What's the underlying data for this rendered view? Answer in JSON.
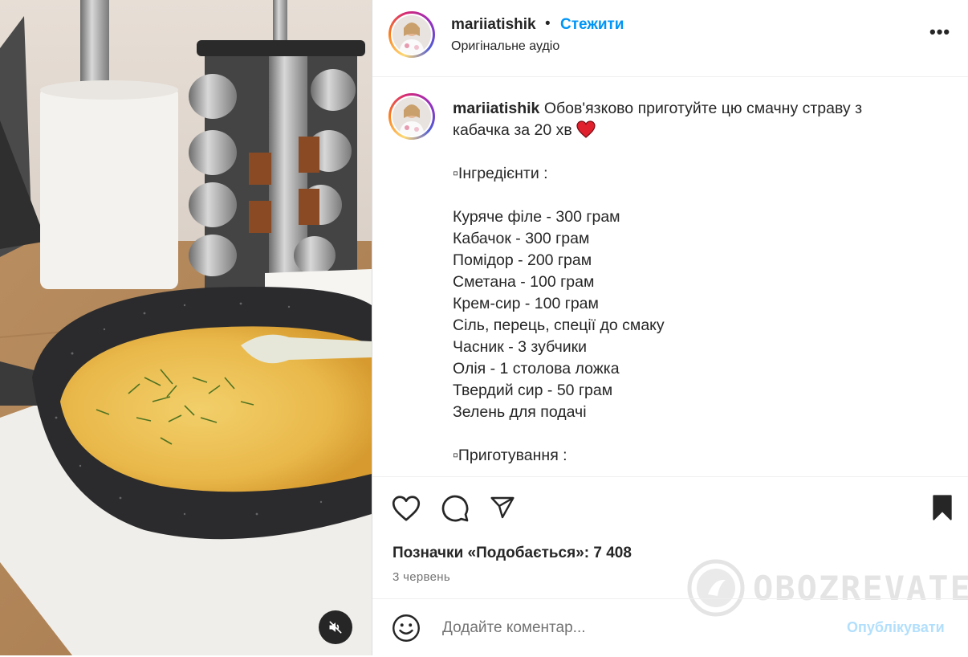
{
  "post": {
    "username": "mariiatishik",
    "separator": "•",
    "follow_label": "Стежити",
    "audio_label": "Оригінальне аудіо",
    "more_label": "•••"
  },
  "caption": {
    "username": "mariiatishik",
    "lines": [
      "Обов'язково приготуйте цю смачну страву з",
      "кабачка за 20 хв",
      "",
      "▫Інгредієнти :",
      "",
      "Куряче філе - 300 грам",
      "Кабачок - 300 грам",
      "Помідор - 200 грам",
      "Сметана - 100 грам",
      "Крем-сир - 100 грам",
      "Сіль, перець, спеції до смаку",
      "Часник - 3 зубчики",
      "Олія - 1 столова ложка",
      "Твердий сир - 50 грам",
      "Зелень для подачі",
      "",
      "▫Приготування :"
    ],
    "emoji": "heart-emoji"
  },
  "actions": {
    "likes_text": "Позначки «Подобається»: 7 408",
    "date_text": "3 червень",
    "icons": [
      "heart-icon",
      "comment-icon",
      "share-icon",
      "bookmark-icon"
    ]
  },
  "comment": {
    "placeholder": "Додайте коментар...",
    "publish_label": "Опублікувати"
  },
  "watermark": {
    "text": "OBOZREVATEL"
  },
  "media": {
    "muted": true
  },
  "colors": {
    "accent": "#0095f6",
    "publish_disabled": "#b2dffc",
    "text": "#262626",
    "secondary": "#737373"
  }
}
